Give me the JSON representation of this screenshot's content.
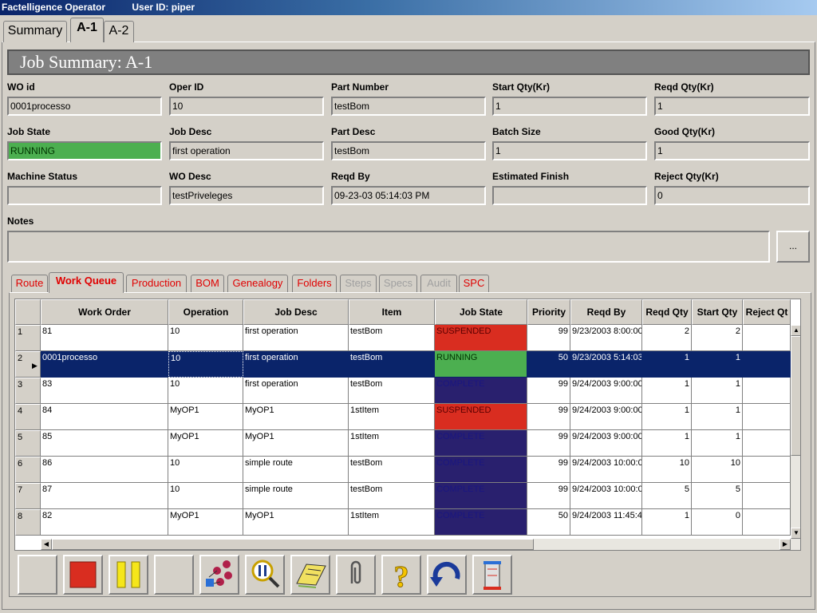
{
  "titlebar": {
    "app": "Factelligence Operator",
    "user": "User ID: piper"
  },
  "main_tabs": [
    "Summary",
    "A-1",
    "A-2"
  ],
  "job_header": "Job Summary: A-1",
  "fields": {
    "wo_id": {
      "label": "WO id",
      "value": "0001processo"
    },
    "oper_id": {
      "label": "Oper ID",
      "value": "10"
    },
    "part_number": {
      "label": "Part Number",
      "value": "testBom"
    },
    "start_qty": {
      "label": "Start Qty(Kr)",
      "value": "1"
    },
    "reqd_qty": {
      "label": "Reqd Qty(Kr)",
      "value": "1"
    },
    "job_state": {
      "label": "Job State",
      "value": "RUNNING"
    },
    "job_desc": {
      "label": "Job Desc",
      "value": "first operation"
    },
    "part_desc": {
      "label": "Part Desc",
      "value": "testBom"
    },
    "batch_size": {
      "label": "Batch Size",
      "value": "1"
    },
    "good_qty": {
      "label": "Good Qty(Kr)",
      "value": "1"
    },
    "machine_status": {
      "label": "Machine Status",
      "value": ""
    },
    "wo_desc": {
      "label": "WO Desc",
      "value": "testPriveleges"
    },
    "reqd_by": {
      "label": "Reqd By",
      "value": "09-23-03 05:14:03 PM"
    },
    "est_finish": {
      "label": "Estimated Finish",
      "value": ""
    },
    "reject_qty": {
      "label": "Reject Qty(Kr)",
      "value": "0"
    },
    "notes": {
      "label": "Notes",
      "value": ""
    },
    "notes_button": "..."
  },
  "sub_tabs": [
    "Route",
    "Work Queue",
    "Production",
    "BOM",
    "Genealogy",
    "Folders",
    "Steps",
    "Specs",
    "Audit",
    "SPC"
  ],
  "grid": {
    "columns": [
      "Work Order",
      "Operation",
      "Job Desc",
      "Item",
      "Job State",
      "Priority",
      "Reqd By",
      "Reqd Qty",
      "Start Qty",
      "Reject Qt"
    ],
    "rows": [
      {
        "n": "1",
        "wo": "81",
        "op": "10",
        "desc": "first operation",
        "item": "testBom",
        "state": "SUSPENDED",
        "prio": "99",
        "reqd": "9/23/2003 8:00:00",
        "rq": "2",
        "sq": "2"
      },
      {
        "n": "2",
        "wo": "0001processo",
        "op": "10",
        "desc": "first operation",
        "item": "testBom",
        "state": "RUNNING",
        "prio": "50",
        "reqd": "9/23/2003 5:14:03",
        "rq": "1",
        "sq": "1"
      },
      {
        "n": "3",
        "wo": "83",
        "op": "10",
        "desc": "first operation",
        "item": "testBom",
        "state": "COMPLETE",
        "prio": "99",
        "reqd": "9/24/2003 9:00:00",
        "rq": "1",
        "sq": "1"
      },
      {
        "n": "4",
        "wo": "84",
        "op": "MyOP1",
        "desc": "MyOP1",
        "item": "1stItem",
        "state": "SUSPENDED",
        "prio": "99",
        "reqd": "9/24/2003 9:00:00",
        "rq": "1",
        "sq": "1"
      },
      {
        "n": "5",
        "wo": "85",
        "op": "MyOP1",
        "desc": "MyOP1",
        "item": "1stItem",
        "state": "COMPLETE",
        "prio": "99",
        "reqd": "9/24/2003 9:00:00",
        "rq": "1",
        "sq": "1"
      },
      {
        "n": "6",
        "wo": "86",
        "op": "10",
        "desc": "simple route",
        "item": "testBom",
        "state": "COMPLETE",
        "prio": "99",
        "reqd": "9/24/2003 10:00:0",
        "rq": "10",
        "sq": "10"
      },
      {
        "n": "7",
        "wo": "87",
        "op": "10",
        "desc": "simple route",
        "item": "testBom",
        "state": "COMPLETE",
        "prio": "99",
        "reqd": "9/24/2003 10:00:0",
        "rq": "5",
        "sq": "5"
      },
      {
        "n": "8",
        "wo": "82",
        "op": "MyOP1",
        "desc": "MyOP1",
        "item": "1stItem",
        "state": "COMPLETE",
        "prio": "50",
        "reqd": "9/24/2003 11:45:4",
        "rq": "1",
        "sq": "0"
      }
    ]
  },
  "toolbar_icons": [
    "blank-button-icon",
    "stop-icon",
    "pause-icon",
    "blank-button-icon",
    "routing-icon",
    "inspect-icon",
    "notebook-icon",
    "paperclip-icon",
    "help-icon",
    "undo-icon",
    "tower-icon"
  ],
  "colors": {
    "running": "#4caf50",
    "suspended": "#d92d20",
    "complete": "#29206e",
    "selection": "#0a246a"
  }
}
